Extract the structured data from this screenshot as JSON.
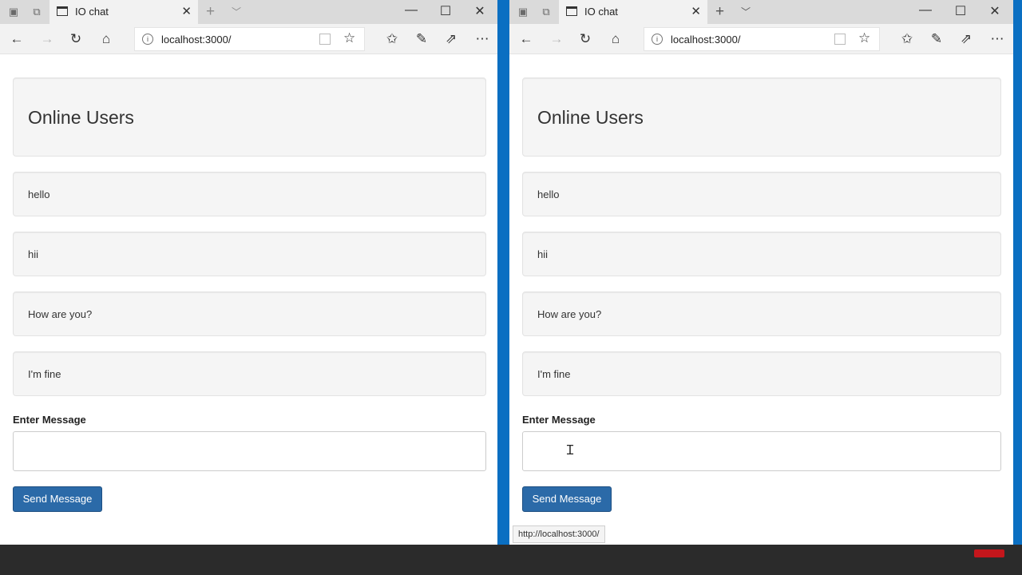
{
  "browser": {
    "tab_title": "IO chat",
    "url": "localhost:3000/",
    "new_tab": "+",
    "tab_list": "﹀",
    "minimize": "—",
    "maximize": "☐",
    "close": "✕"
  },
  "page": {
    "heading": "Online Users",
    "messages": [
      "hello",
      "hii",
      "How are you?",
      "I'm fine"
    ],
    "input_label": "Enter Message",
    "send_label": "Send Message"
  },
  "status_link": "http://localhost:3000/",
  "colors": {
    "accent": "#2b6aa8",
    "desktop": "#0a6fc2"
  }
}
